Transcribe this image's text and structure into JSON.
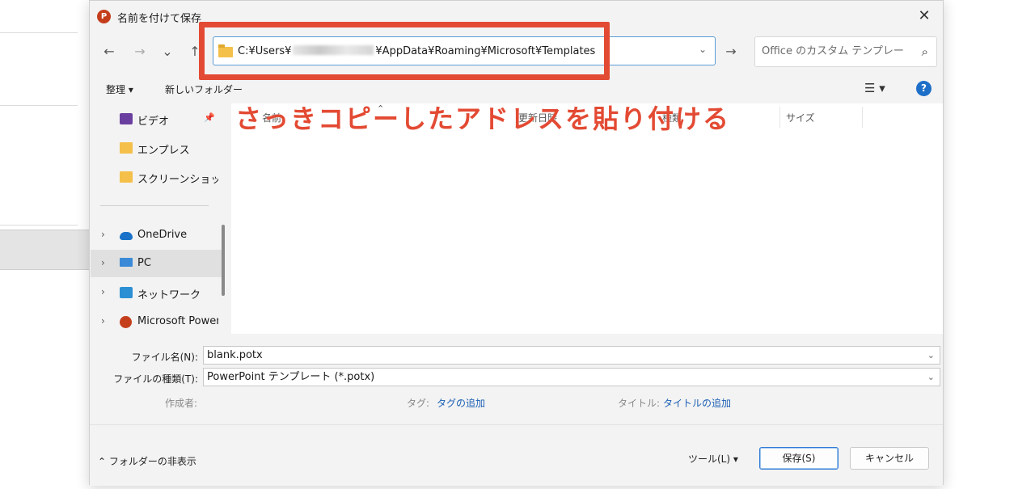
{
  "dialog": {
    "title": "名前を付けて保存",
    "app_icon": "P",
    "close": "✕"
  },
  "nav": {
    "back": "←",
    "forward": "→",
    "recent": "⌄",
    "up": "↑",
    "address_prefix": "C:¥Users¥",
    "address_suffix": "¥AppData¥Roaming¥Microsoft¥Templates",
    "address_dropdown": "⌄",
    "go": "→",
    "search_placeholder": "Office のカスタム テンプレートの...",
    "search_icon": "⌕"
  },
  "toolbar": {
    "organize": "整理 ▾",
    "new_folder": "新しいフォルダー",
    "view_icon": "☰ ▾",
    "help_icon": "?"
  },
  "sidebar": {
    "items": [
      {
        "label": "ビデオ",
        "icon": "video-icon",
        "pin": "📌"
      },
      {
        "label": "エンプレス",
        "icon": "folder-icon"
      },
      {
        "label": "スクリーンショット",
        "icon": "folder-icon"
      },
      {
        "label": "OneDrive",
        "icon": "cloud-icon",
        "chevron": "›"
      },
      {
        "label": "PC",
        "icon": "pc-icon",
        "chevron": "›"
      },
      {
        "label": "ネットワーク",
        "icon": "network-icon",
        "chevron": "›"
      },
      {
        "label": "Microsoft Power",
        "icon": "powerpoint-icon",
        "chevron": "›"
      }
    ]
  },
  "columns": {
    "name": "名前",
    "sort": "⌃",
    "modified": "更新日時",
    "type": "種類",
    "size": "サイズ"
  },
  "annotation": {
    "text": "さっきコピーしたアドレスを貼り付ける"
  },
  "form": {
    "filename_label": "ファイル名(N):",
    "filename_value": "blank.potx",
    "filetype_label": "ファイルの種類(T):",
    "filetype_value": "PowerPoint テンプレート (*.potx)",
    "dropdown": "⌄",
    "author_label": "作成者:",
    "tags_label": "タグ:",
    "tags_link": "タグの追加",
    "title_label": "タイトル:",
    "title_link": "タイトルの追加"
  },
  "footer": {
    "hide_folders": "⌃ フォルダーの非表示",
    "tools": "ツール(L)  ▾",
    "save": "保存(S)",
    "cancel": "キャンセル"
  }
}
